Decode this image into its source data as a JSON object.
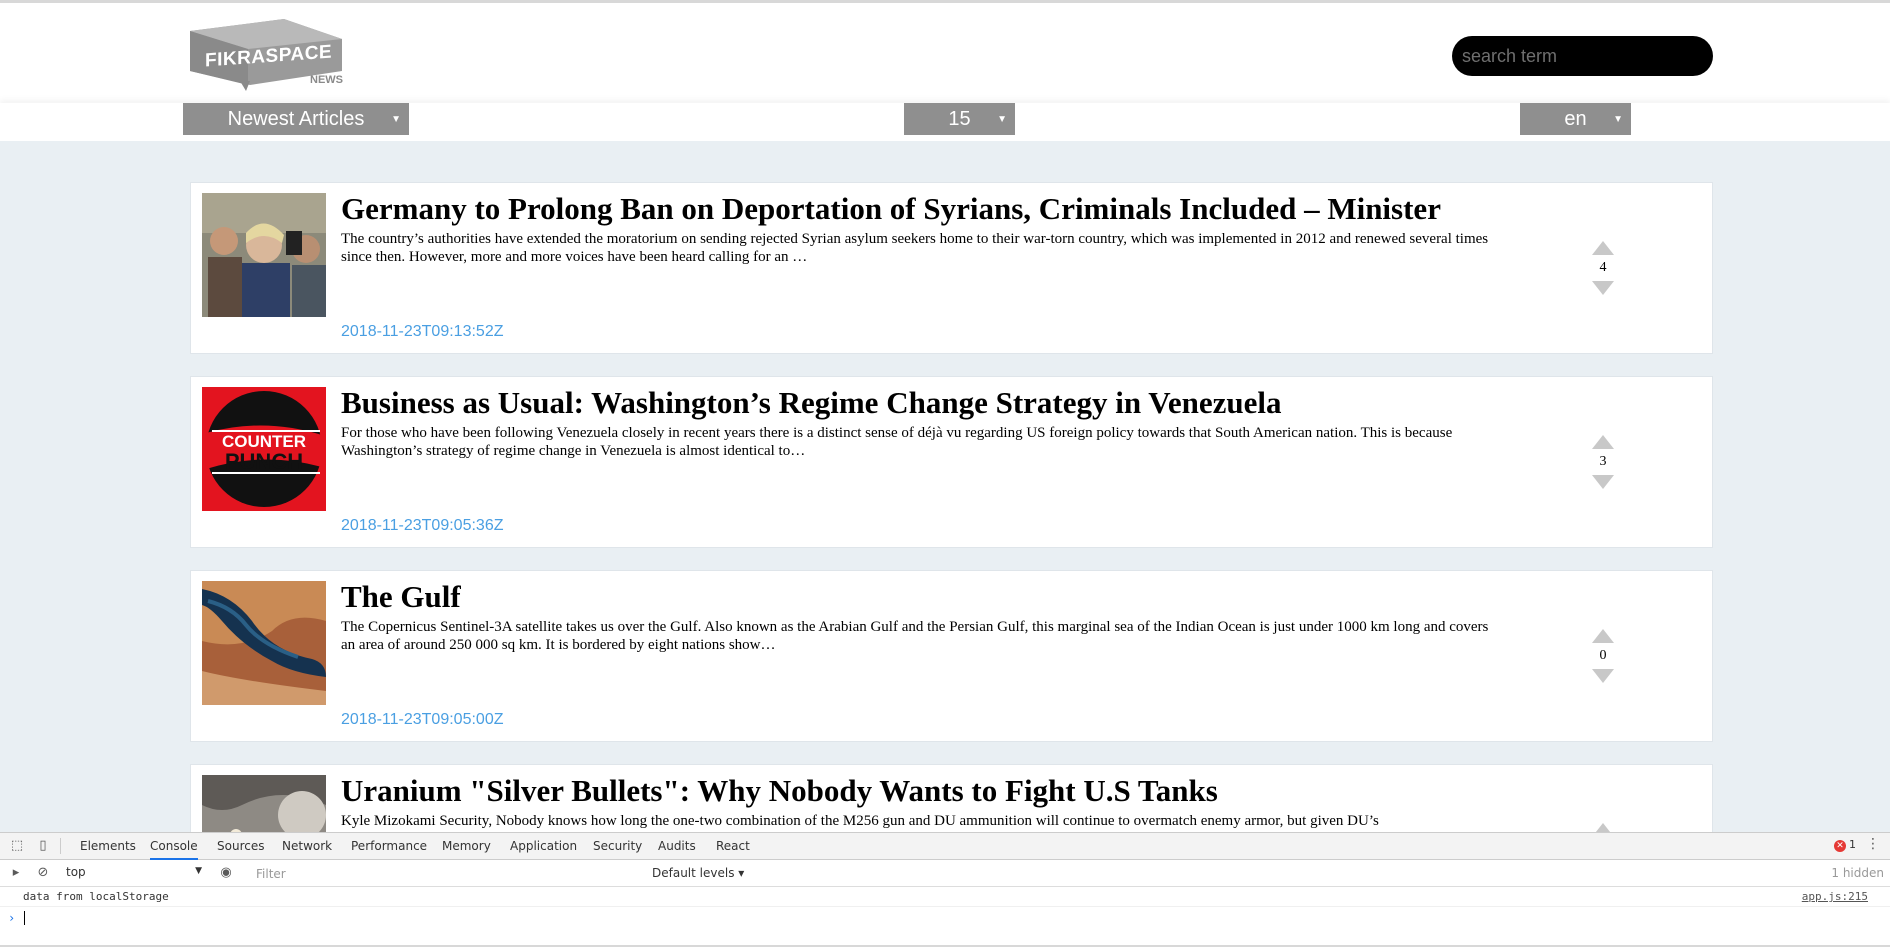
{
  "header": {
    "logo_text": "FIKRASPACE",
    "logo_sub": "NEWS",
    "search_placeholder": "search term"
  },
  "filters": {
    "sort": {
      "selected": "Newest Articles"
    },
    "count": {
      "selected": "15"
    },
    "language": {
      "selected": "en"
    }
  },
  "articles": [
    {
      "title": "Germany to Prolong Ban on Deportation of Syrians, Criminals Included – Minister",
      "summary": "The country’s authorities have extended the moratorium on sending rejected Syrian asylum seekers home to their war-torn country, which was implemented in 2012 and renewed several times since then. However, more and more voices have been heard calling for an …",
      "date": "2018-11-23T09:13:52Z",
      "votes": "4"
    },
    {
      "title": "Business as Usual: Washington’s Regime Change Strategy in Venezuela",
      "summary": "For those who have been following Venezuela closely in recent years there is a distinct sense of déjà vu regarding US foreign policy towards that South American nation. This is because Washington’s strategy of regime change in Venezuela is almost identical to…",
      "date": "2018-11-23T09:05:36Z",
      "votes": "3",
      "thumb_text_1": "COUNTER",
      "thumb_text_2": "PUNCH"
    },
    {
      "title": "The Gulf",
      "summary": "The Copernicus Sentinel-3A satellite takes us over the Gulf. Also known as the Arabian Gulf and the Persian Gulf, this marginal sea of the Indian Ocean is just under 1000 km long and covers an area of around 250 000 sq km. It is bordered by eight nations show…",
      "date": "2018-11-23T09:05:00Z",
      "votes": "0"
    },
    {
      "title": "Uranium \"Silver Bullets\": Why Nobody Wants to Fight U.S Tanks",
      "summary": "Kyle Mizokami Security, Nobody knows how long the one-two combination of the M256 gun and DU ammunition will continue to overmatch enemy armor, but given DU’s",
      "date": "",
      "votes": ""
    }
  ],
  "devtools": {
    "tabs": [
      "Elements",
      "Console",
      "Sources",
      "Network",
      "Performance",
      "Memory",
      "Application",
      "Security",
      "Audits",
      "React"
    ],
    "active_tab": "Console",
    "context": "top",
    "filter_placeholder": "Filter",
    "levels": "Default levels ▾",
    "hidden": "1 hidden",
    "error_count": "1",
    "log_message": "data from localStorage",
    "log_source": "app.js:215",
    "prompt": "›"
  }
}
